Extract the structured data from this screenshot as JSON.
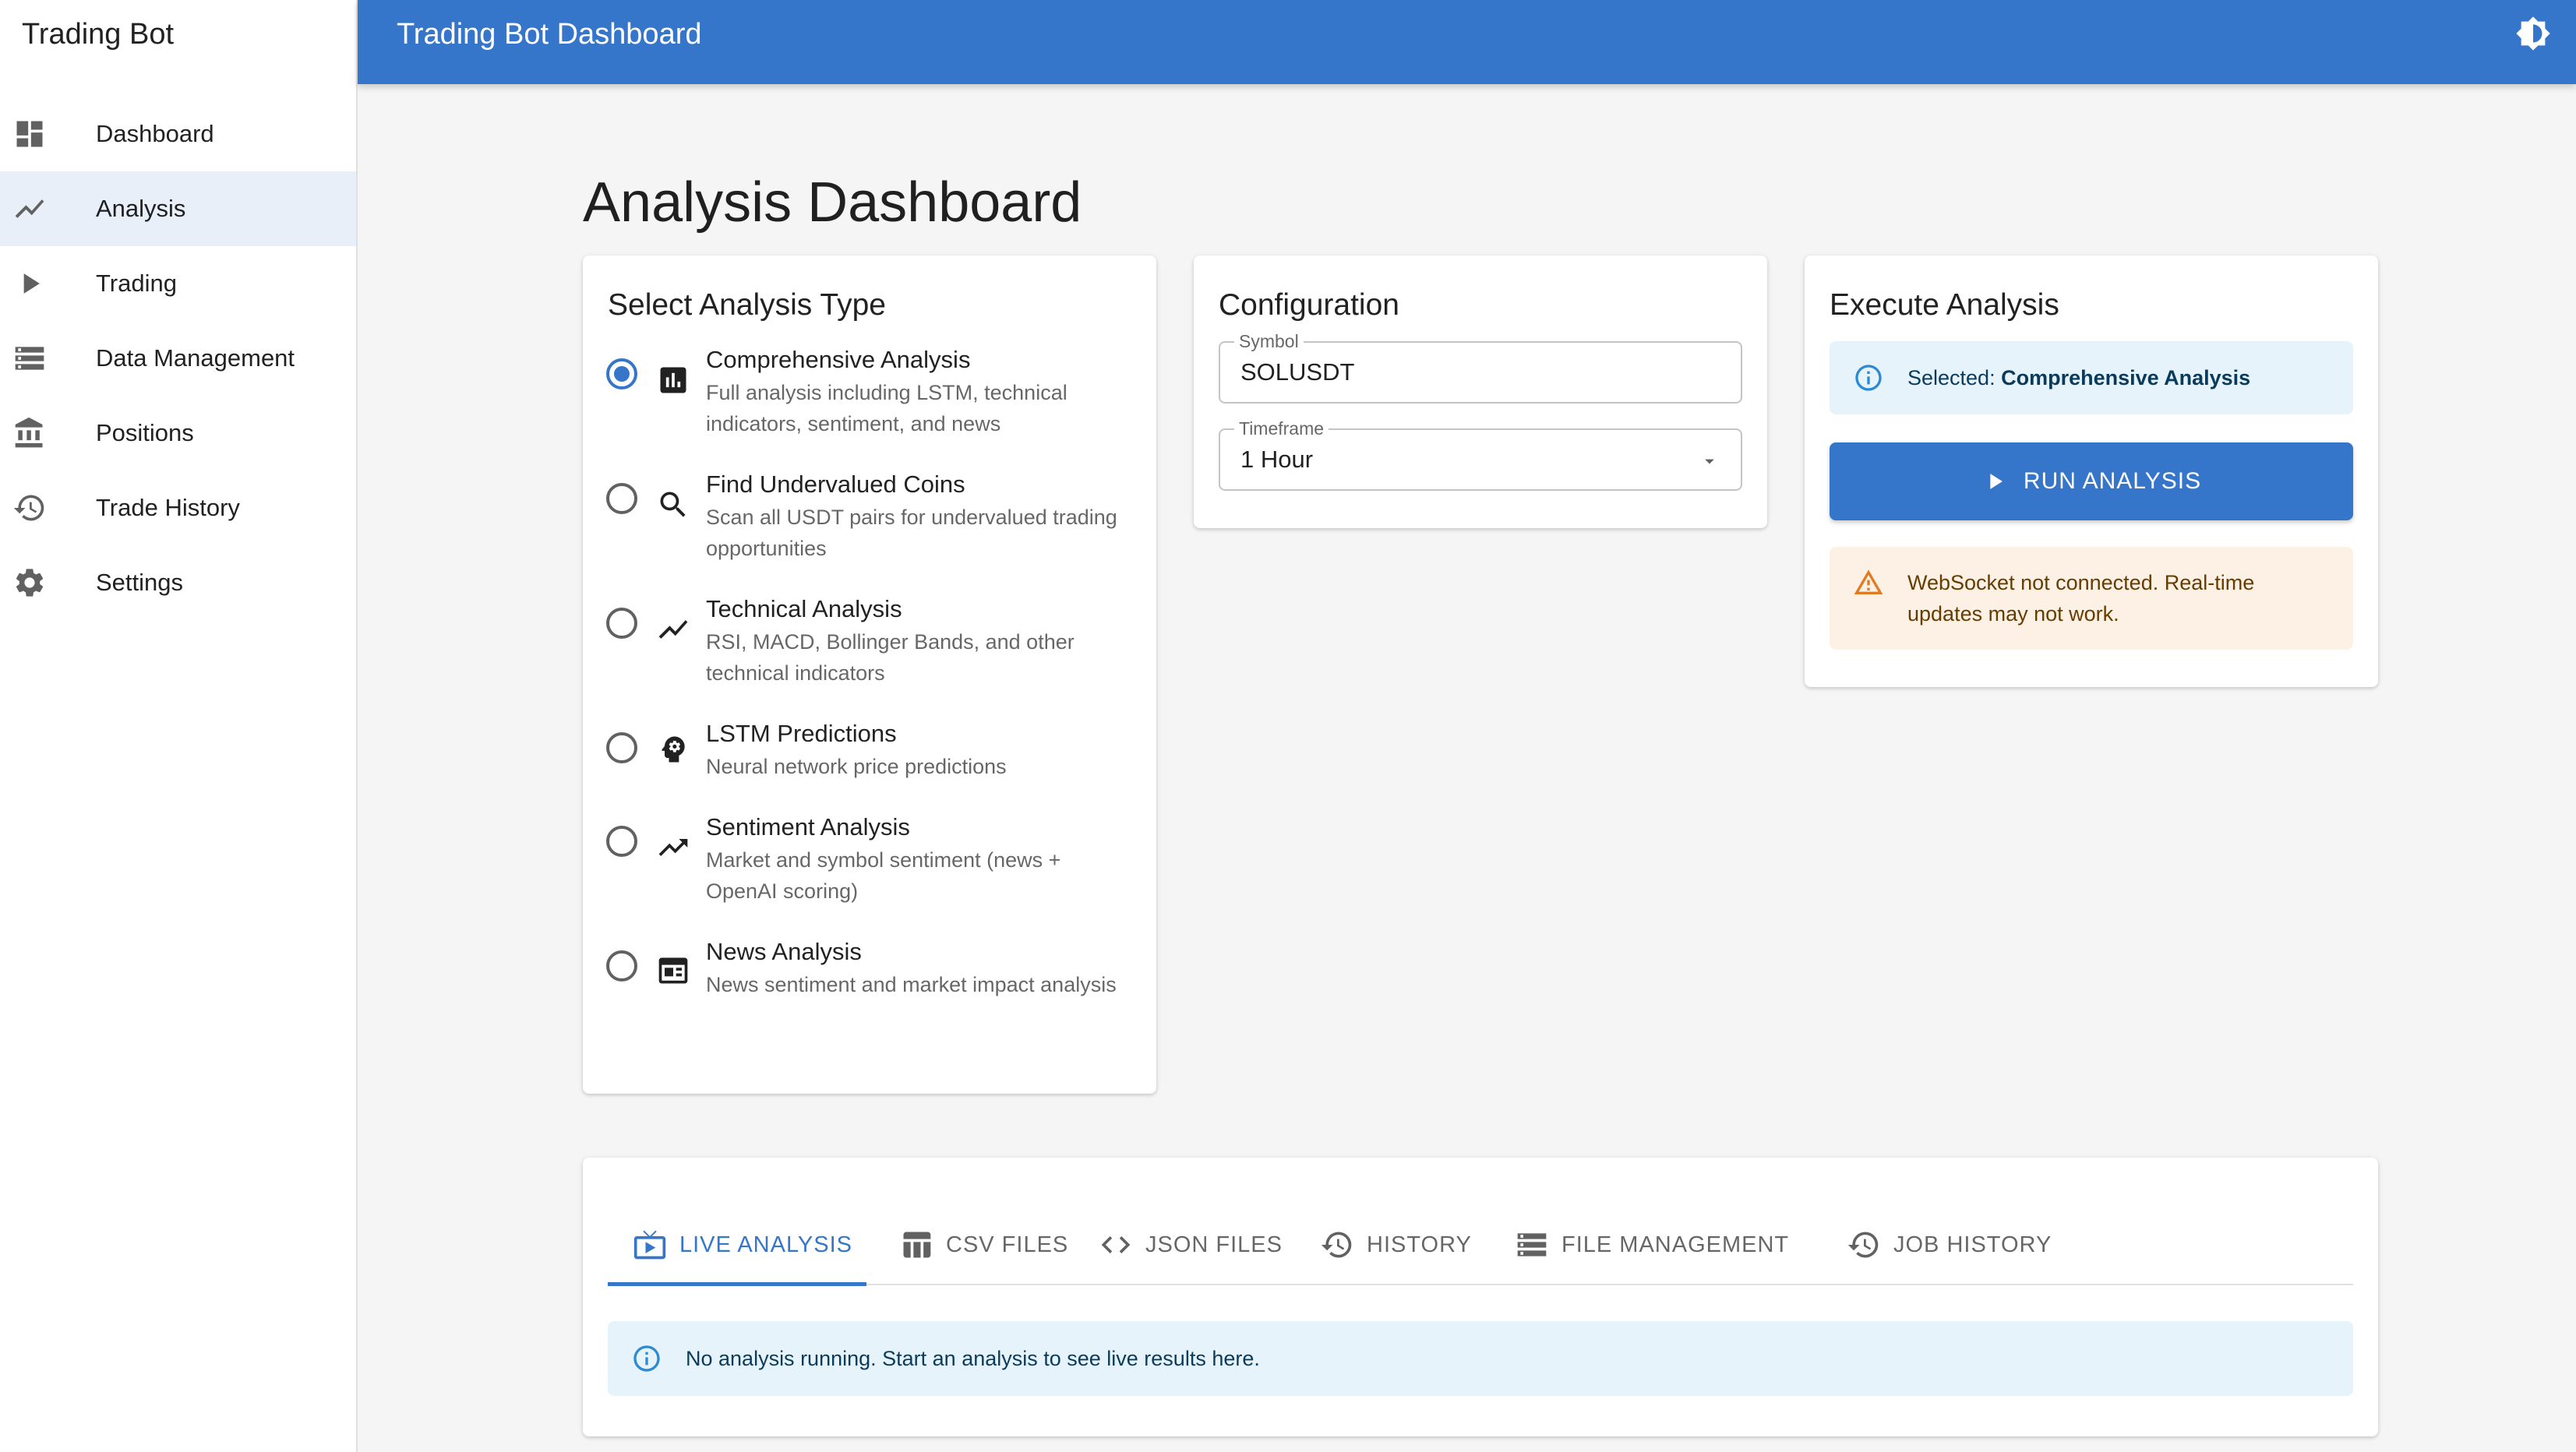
{
  "app": {
    "title": "Trading Bot"
  },
  "appbar": {
    "title": "Trading Bot Dashboard",
    "theme_icon": "brightness-icon"
  },
  "sidebar": {
    "items": [
      {
        "label": "Dashboard",
        "icon": "dashboard-icon",
        "active": false
      },
      {
        "label": "Analysis",
        "icon": "trending-up-icon",
        "active": true
      },
      {
        "label": "Trading",
        "icon": "play-icon",
        "active": false
      },
      {
        "label": "Data Management",
        "icon": "storage-icon",
        "active": false
      },
      {
        "label": "Positions",
        "icon": "bank-icon",
        "active": false
      },
      {
        "label": "Trade History",
        "icon": "history-icon",
        "active": false
      },
      {
        "label": "Settings",
        "icon": "gear-icon",
        "active": false
      }
    ]
  },
  "page": {
    "title": "Analysis Dashboard"
  },
  "analysis_types": {
    "title": "Select Analysis Type",
    "options": [
      {
        "title": "Comprehensive Analysis",
        "desc": "Full analysis including LSTM, technical indicators, sentiment, and news",
        "icon": "bar-chart-icon",
        "selected": true
      },
      {
        "title": "Find Undervalued Coins",
        "desc": "Scan all USDT pairs for undervalued trading opportunities",
        "icon": "search-icon",
        "selected": false
      },
      {
        "title": "Technical Analysis",
        "desc": "RSI, MACD, Bollinger Bands, and other technical indicators",
        "icon": "show-chart-icon",
        "selected": false
      },
      {
        "title": "LSTM Predictions",
        "desc": "Neural network price predictions",
        "icon": "psychology-icon",
        "selected": false
      },
      {
        "title": "Sentiment Analysis",
        "desc": "Market and symbol sentiment (news + OpenAI scoring)",
        "icon": "trending-up-icon",
        "selected": false
      },
      {
        "title": "News Analysis",
        "desc": "News sentiment and market impact analysis",
        "icon": "newspaper-icon",
        "selected": false
      }
    ]
  },
  "configuration": {
    "title": "Configuration",
    "symbol": {
      "label": "Symbol",
      "value": "SOLUSDT"
    },
    "timeframe": {
      "label": "Timeframe",
      "value": "1 Hour"
    }
  },
  "execute": {
    "title": "Execute Analysis",
    "selected_prefix": "Selected: ",
    "selected_value": "Comprehensive Analysis",
    "run_label": "RUN ANALYSIS",
    "warning": "WebSocket not connected. Real-time updates may not work."
  },
  "results": {
    "tabs": [
      {
        "label": "LIVE ANALYSIS",
        "icon": "live-tv-icon",
        "active": true
      },
      {
        "label": "CSV FILES",
        "icon": "table-icon",
        "active": false
      },
      {
        "label": "JSON FILES",
        "icon": "code-icon",
        "active": false
      },
      {
        "label": "HISTORY",
        "icon": "history-icon",
        "active": false
      },
      {
        "label": "FILE MANAGEMENT",
        "icon": "storage-icon",
        "active": false
      },
      {
        "label": "JOB HISTORY",
        "icon": "history-icon",
        "active": false
      }
    ],
    "info": "No analysis running. Start an analysis to see live results here."
  },
  "colors": {
    "primary": "#3576cb",
    "info_bg": "#e6f3fb",
    "warning_bg": "#fdf0e4",
    "warning": "#e07b24",
    "info": "#2c8ad3"
  }
}
